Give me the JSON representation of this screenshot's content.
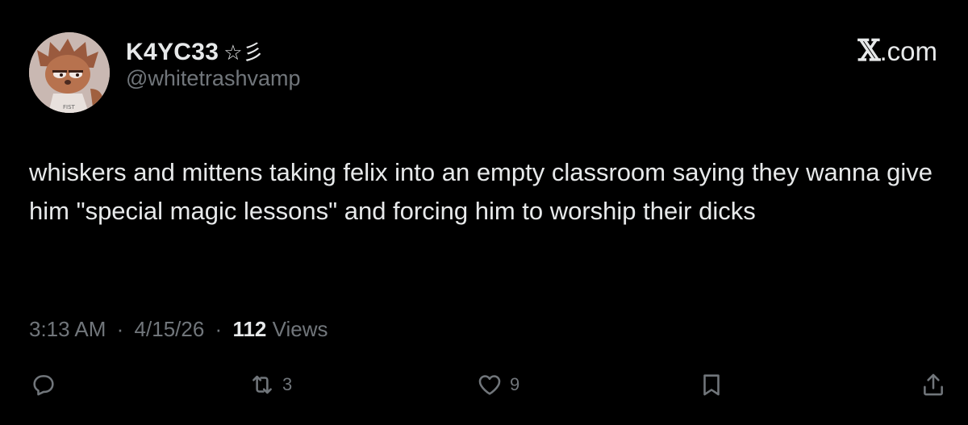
{
  "post": {
    "author": {
      "display_name": "K4YC33",
      "name_emoji": "☆彡",
      "handle": "@whitetrashvamp",
      "avatar_text": "FIST"
    },
    "site": {
      "x_glyph": "𝕏",
      "suffix": ".com"
    },
    "text": "whiskers and mittens taking felix into an empty classroom saying they wanna give him \"special magic lessons\" and forcing him to worship their dicks",
    "meta": {
      "time": "3:13 AM",
      "date": "4/15/26",
      "separator": "·",
      "views_count": "112",
      "views_label": "Views"
    },
    "actions": {
      "reply_icon": "reply-icon",
      "retweet_icon": "retweet-icon",
      "retweet_count": "3",
      "like_icon": "heart-icon",
      "like_count": "9",
      "bookmark_icon": "bookmark-icon",
      "share_icon": "share-icon"
    }
  },
  "colors": {
    "background": "#000000",
    "primary_text": "#e7e9ea",
    "secondary_text": "#71767b"
  }
}
